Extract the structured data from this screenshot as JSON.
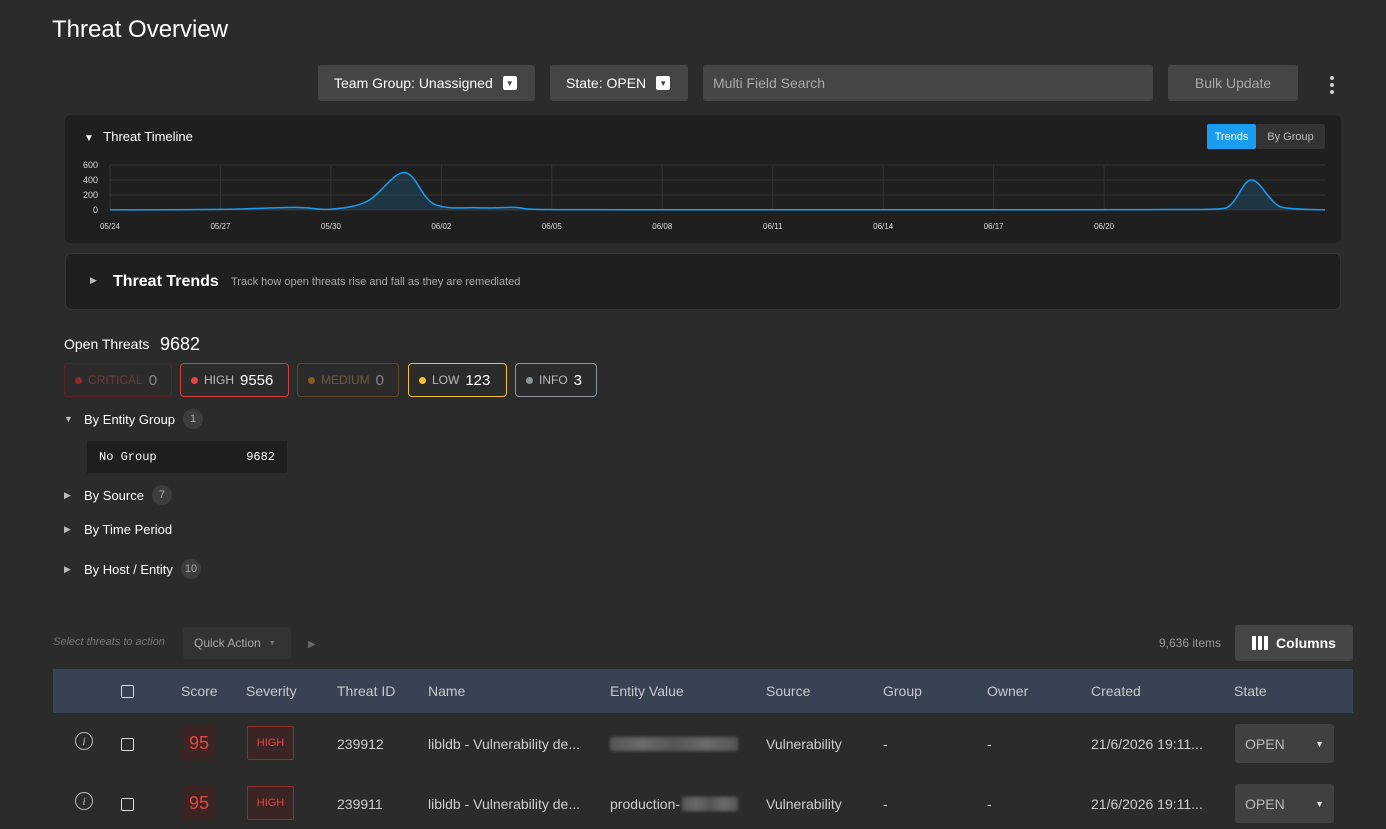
{
  "page_title": "Threat Overview",
  "toolbar": {
    "team_group_label": "Team Group: Unassigned",
    "state_label": "State: OPEN",
    "search_placeholder": "Multi Field Search",
    "bulk_update_label": "Bulk Update"
  },
  "timeline": {
    "title": "Threat Timeline",
    "toggle_trends": "Trends",
    "toggle_by_group": "By Group",
    "accent": "#1a9cf0"
  },
  "chart_data": {
    "type": "area",
    "title": "Threat Timeline",
    "x_ticks": [
      "05/24",
      "05/27",
      "05/30",
      "06/02",
      "06/05",
      "06/08",
      "06/11",
      "06/14",
      "06/17",
      "06/20"
    ],
    "y_ticks": [
      "600",
      "400",
      "200",
      "0"
    ],
    "ylim": [
      0,
      650
    ],
    "grid": true,
    "series": [
      {
        "points": [
          [
            0,
            2
          ],
          [
            3,
            8
          ],
          [
            5,
            35
          ],
          [
            6,
            10
          ],
          [
            7,
            120
          ],
          [
            8,
            500
          ],
          [
            8.8,
            80
          ],
          [
            10,
            30
          ],
          [
            11,
            35
          ],
          [
            11.6,
            8
          ],
          [
            14,
            4
          ],
          [
            20,
            3
          ],
          [
            26,
            3
          ],
          [
            29,
            6
          ],
          [
            30.3,
            25
          ],
          [
            31,
            400
          ],
          [
            31.8,
            40
          ],
          [
            33,
            2
          ]
        ]
      }
    ]
  },
  "trends": {
    "title": "Threat Trends",
    "subtitle": "Track how open threats rise and fall as they are remediated"
  },
  "open_threats": {
    "label": "Open Threats",
    "count": "9682",
    "severities": [
      {
        "label": "CRITICAL",
        "count": "0",
        "color": "#8b2b2b"
      },
      {
        "label": "HIGH",
        "count": "9556",
        "color": "#e5463f"
      },
      {
        "label": "MEDIUM",
        "count": "0",
        "color": "#8a5a1c"
      },
      {
        "label": "LOW",
        "count": "123",
        "color": "#f2c230"
      },
      {
        "label": "INFO",
        "count": "3",
        "color": "#8a94a0"
      }
    ]
  },
  "groups": {
    "by_entity_group": {
      "label": "By Entity Group",
      "count": "1"
    },
    "no_group": {
      "label": "No Group",
      "count": "9682"
    },
    "by_source": {
      "label": "By Source",
      "count": "7"
    },
    "by_time_period": {
      "label": "By Time Period"
    },
    "by_host": {
      "label": "By Host / Entity",
      "count": "10"
    }
  },
  "table_toolbar": {
    "select_hint": "Select threats to action",
    "quick_action": "Quick Action",
    "items_count": "9,636 items",
    "columns_label": "Columns"
  },
  "table": {
    "headers": [
      "Score",
      "Severity",
      "Threat ID",
      "Name",
      "Entity Value",
      "Source",
      "Group",
      "Owner",
      "Created",
      "State"
    ],
    "rows": [
      {
        "score": "95",
        "severity": "HIGH",
        "threat_id": "239912",
        "name": "libldb - Vulnerability de...",
        "entity_value": "",
        "source": "Vulnerability",
        "group": "-",
        "owner": "-",
        "created": "21/6/2026 19:11...",
        "state": "OPEN"
      },
      {
        "score": "95",
        "severity": "HIGH",
        "threat_id": "239911",
        "name": "libldb - Vulnerability de...",
        "entity_value": "production-",
        "source": "Vulnerability",
        "group": "-",
        "owner": "-",
        "created": "21/6/2026 19:11...",
        "state": "OPEN"
      }
    ]
  }
}
